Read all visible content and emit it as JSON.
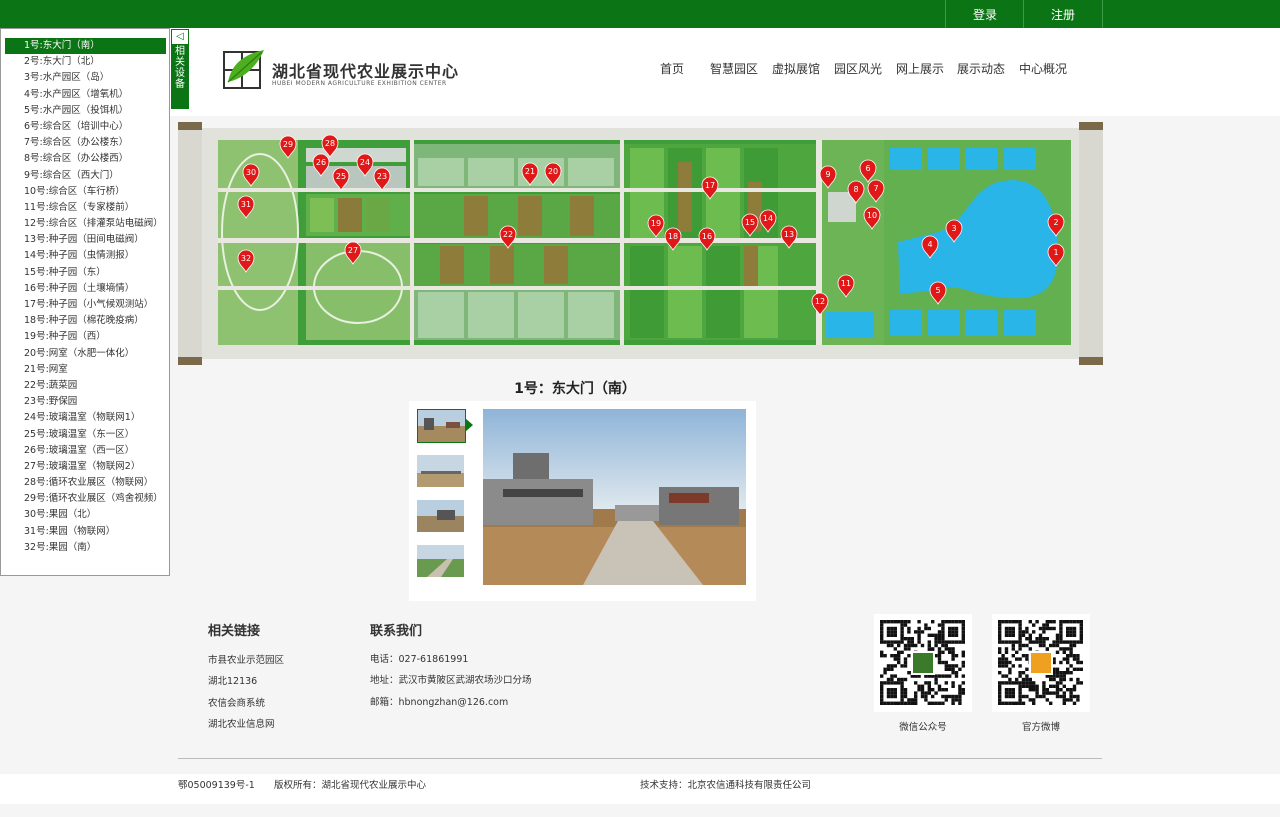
{
  "auth": {
    "login": "登录",
    "register": "注册"
  },
  "brand": {
    "name": "湖北省现代农业展示中心",
    "sub": "HUBEI MODERN AGRICULTURE EXHIBITION CENTER"
  },
  "nav": [
    "首页",
    "智慧园区",
    "虚拟展馆",
    "园区风光",
    "网上展示",
    "展示动态",
    "中心概况"
  ],
  "side_tab": {
    "arrow": "◁",
    "label": "相关设备"
  },
  "sites": [
    "1号:东大门（南）",
    "2号:东大门（北）",
    "3号:水产园区（岛）",
    "4号:水产园区（增氧机）",
    "5号:水产园区（投饵机）",
    "6号:综合区（培训中心）",
    "7号:综合区（办公楼东）",
    "8号:综合区（办公楼西）",
    "9号:综合区（西大门）",
    "10号:综合区（车行桥）",
    "11号:综合区（专家楼前）",
    "12号:综合区（排灌泵站电磁阀）",
    "13号:种子园（田间电磁阀）",
    "14号:种子园（虫情测报）",
    "15号:种子园（东）",
    "16号:种子园（土壤墒情）",
    "17号:种子园（小气候观测站）",
    "18号:种子园（棉花晚疫病）",
    "19号:种子园（西）",
    "20号:网室（水肥一体化）",
    "21号:网室",
    "22号:蔬菜园",
    "23号:野保园",
    "24号:玻璃温室（物联网1）",
    "25号:玻璃温室（东一区）",
    "26号:玻璃温室（西一区）",
    "27号:玻璃温室（物联网2）",
    "28号:循环农业展区（物联网）",
    "29号:循环农业展区（鸡舍视频）",
    "30号:果园（北）",
    "31号:果园（物联网）",
    "32号:果园（南）"
  ],
  "active_site": 0,
  "map_markers": [
    "1",
    "2",
    "3",
    "4",
    "5",
    "6",
    "7",
    "8",
    "9",
    "10",
    "11",
    "12",
    "13",
    "14",
    "15",
    "16",
    "17",
    "18",
    "19",
    "20",
    "21",
    "22",
    "23",
    "24",
    "25",
    "26",
    "27",
    "28",
    "29",
    "30",
    "31",
    "32"
  ],
  "caption": "1号：东大门（南）",
  "footer": {
    "links_title": "相关链接",
    "links": [
      "市县农业示范园区",
      "湖北12136",
      "农信会商系统",
      "湖北农业信息网"
    ],
    "contact_title": "联系我们",
    "phone": "电话：027-61861991",
    "address": "地址：武汉市黄陂区武湖农场沙口分场",
    "email": "邮箱：hbnongzhan@126.com",
    "qr1_label": "微信公众号",
    "qr2_label": "官方微博"
  },
  "bottom": {
    "icp": "鄂05009139号-1",
    "copyright": "版权所有：湖北省现代农业展示中心",
    "support": "技术支持：北京农信通科技有限责任公司"
  },
  "colors": {
    "brand_green": "#0b7515",
    "water": "#29b5e8",
    "marker": "#e01818"
  }
}
